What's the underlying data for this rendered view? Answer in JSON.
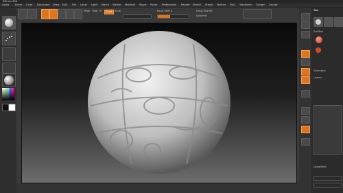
{
  "app": {
    "title": "ZBrush 4R6",
    "menus": [
      "Alpha",
      "Brush",
      "Color",
      "Document",
      "Draw",
      "Edit",
      "File",
      "Layer",
      "Light",
      "Macro",
      "Marker",
      "Material",
      "Movie",
      "Picker",
      "Preferences",
      "Render",
      "Stencil",
      "Stroke",
      "Texture",
      "Tool",
      "Transform",
      "Zplugin",
      "Zscript"
    ]
  },
  "topbar": {
    "mrgb": "Mrgb",
    "rgb": "Rgb",
    "m": "M",
    "zadd": "Zadd",
    "zsub": "Zsub",
    "focal_shift": "Focal Shift 0",
    "draw_size": "Draw Size 64",
    "dynamic": "Dynamic"
  },
  "right_panel": {
    "header": "Tool",
    "subtool": "SubTool",
    "geometry": "Geometry",
    "layers": "Layers",
    "dynamesh": "DynaMesh"
  },
  "colors": {
    "accent": "#e0741c",
    "viewport_top": "#0a0a0a",
    "viewport_bottom": "#6c6c6c"
  }
}
